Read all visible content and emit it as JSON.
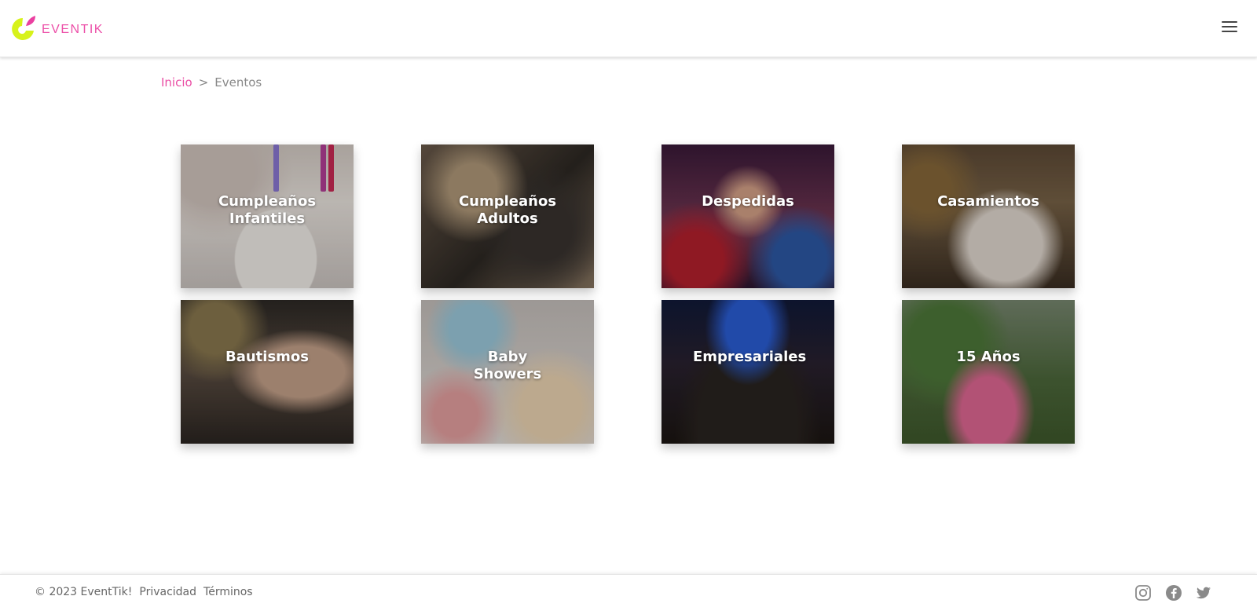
{
  "header": {
    "brand": "EVENTIK",
    "logo_colors": {
      "yellow": "#d7f21a",
      "pink": "#ea3fa0"
    },
    "menu_icon": "hamburger-icon"
  },
  "breadcrumb": {
    "home": "Inicio",
    "separator": ">",
    "current": "Eventos"
  },
  "events": [
    {
      "title": "Cumpleaños Infantiles"
    },
    {
      "title": "Cumpleaños Adultos"
    },
    {
      "title": "Despedidas"
    },
    {
      "title": "Casamientos"
    },
    {
      "title": "Bautismos"
    },
    {
      "title": "Baby Showers"
    },
    {
      "title": "Empresariales"
    },
    {
      "title": "15 Años"
    }
  ],
  "footer": {
    "copyright": "© 2023 EventTik!",
    "privacy": "Privacidad",
    "terms": "Términos",
    "social": [
      "instagram-icon",
      "facebook-icon",
      "twitter-icon"
    ]
  },
  "colors": {
    "accent": "#ea4ea5",
    "text": "#666666"
  }
}
